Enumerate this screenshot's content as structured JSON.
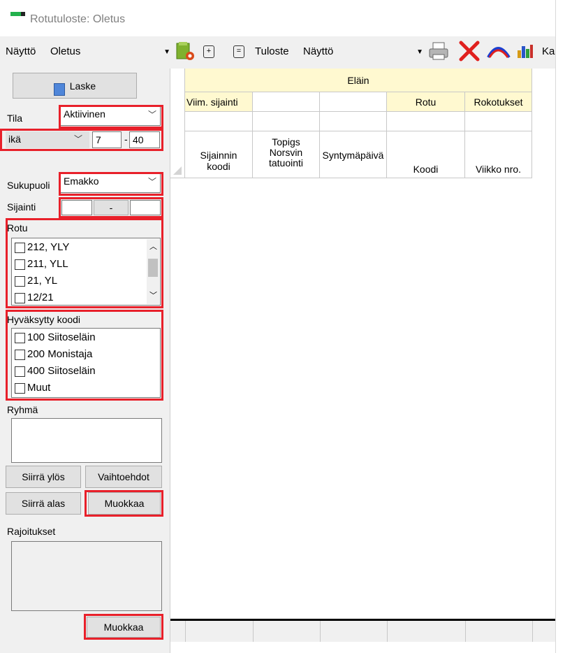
{
  "window": {
    "title": "Rotutuloste: Oletus"
  },
  "toolbar": {
    "view_label": "Näyttö",
    "view_value": "Oletus",
    "output_label": "Tuloste",
    "output_value": "Näyttö",
    "plus_glyph": "+",
    "minus_glyph": "=",
    "cut_label": "Ka"
  },
  "left": {
    "calc_button": "Laske",
    "state_label": "Tila",
    "state_value": "Aktiivinen",
    "age_field": "ikä",
    "age_from": "7",
    "age_dash": "-",
    "age_to": "40",
    "gender_label": "Sukupuoli",
    "gender_value": "Emakko",
    "location_label": "Sijainti",
    "location_dash": "-",
    "breed_header": "Rotu",
    "breed_items": [
      "212, YLY",
      "211, YLL",
      "21, YL",
      "12/21"
    ],
    "code_header": "Hyväksytty koodi",
    "code_items": [
      "100 Siitoseläin",
      "200 Monistaja",
      "400 Siitoseläin",
      "Muut"
    ],
    "group_label": "Ryhmä",
    "move_up": "Siirrä ylös",
    "options": "Vaihtoehdot",
    "move_down": "Siirrä alas",
    "edit": "Muokkaa",
    "restrictions_label": "Rajoitukset",
    "edit2": "Muokkaa"
  },
  "grid": {
    "group_header": "Eläin",
    "sub_headers": [
      "Viim. sijainti",
      "",
      "",
      "Rotu",
      "Rokotukset"
    ],
    "col_headers": [
      "Sijainnin koodi",
      "Topigs Norsvin tatuointi",
      "Syntymäpäivä",
      "Koodi",
      "Viikko nro."
    ]
  }
}
